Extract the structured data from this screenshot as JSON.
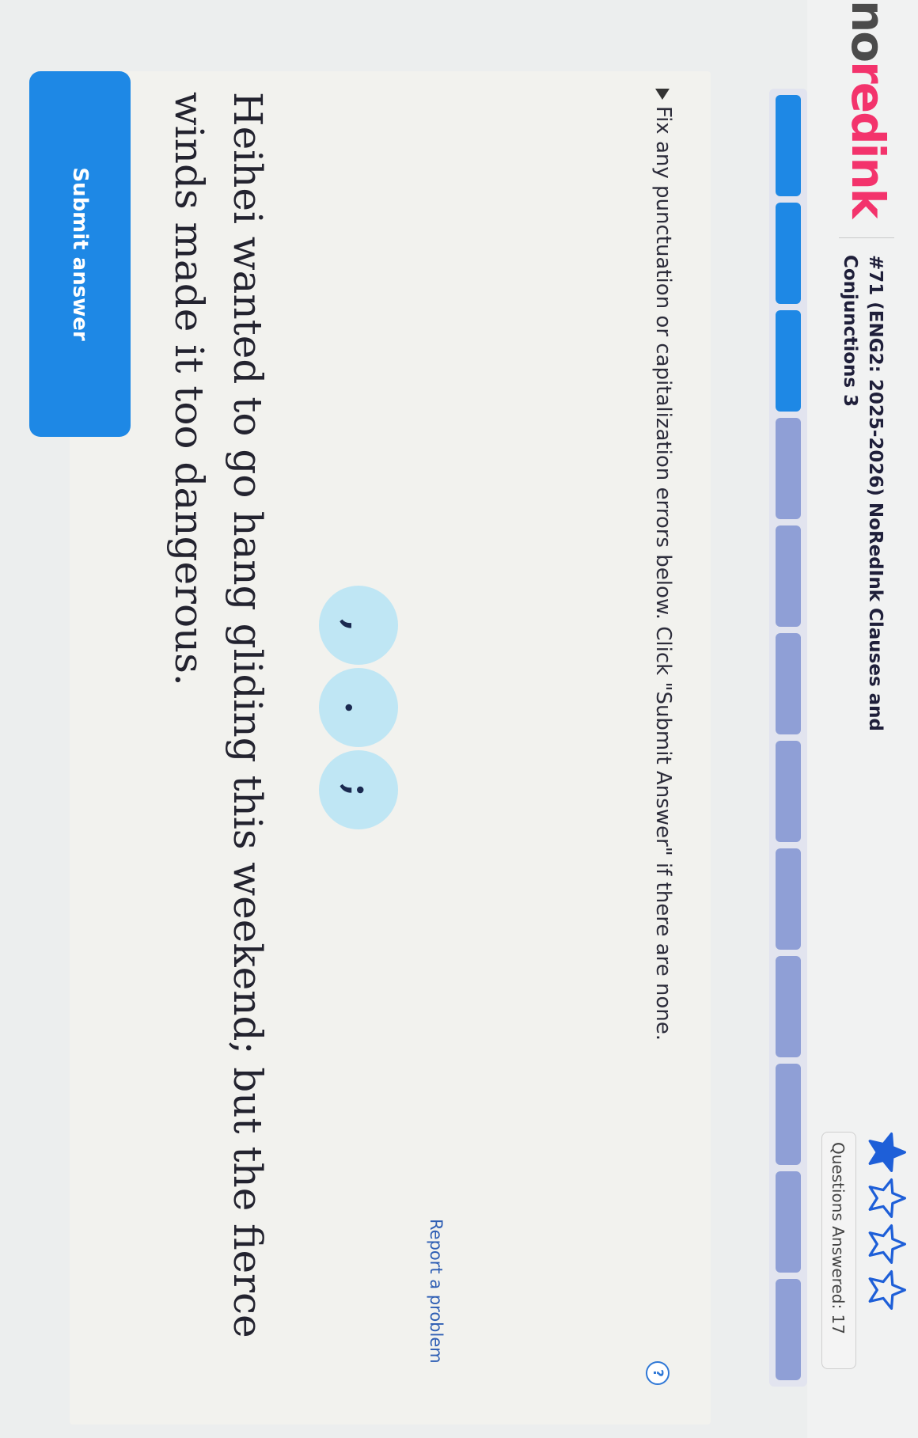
{
  "header": {
    "logo_part1": "no",
    "logo_part2": "redink",
    "assignment_title": "#71 (ENG2: 2025-2026) NoRedInk Clauses and Conjunctions 3",
    "questions_answered": "Questions Answered: 17",
    "stars": [
      "star-filled-icon",
      "star-outline-icon",
      "star-outline-icon",
      "star-outline-icon"
    ]
  },
  "progress": {
    "segments": [
      "filled",
      "filled",
      "filled",
      "empty",
      "empty",
      "empty",
      "empty",
      "empty",
      "empty",
      "empty",
      "empty",
      "empty"
    ],
    "filled_color": "#1e88e5",
    "empty_color": "#8f9fd6"
  },
  "question": {
    "instruction": "Fix any punctuation or capitalization errors below. Click \"Submit Answer\" if there are none.",
    "help_icon_text": "?",
    "tiles": [
      ",",
      ".",
      ";"
    ],
    "sentence": "Heihei wanted to go hang gliding this weekend; but the fierce winds made it too dangerous."
  },
  "actions": {
    "submit_label": "Submit answer",
    "report_label": "Report a problem"
  }
}
